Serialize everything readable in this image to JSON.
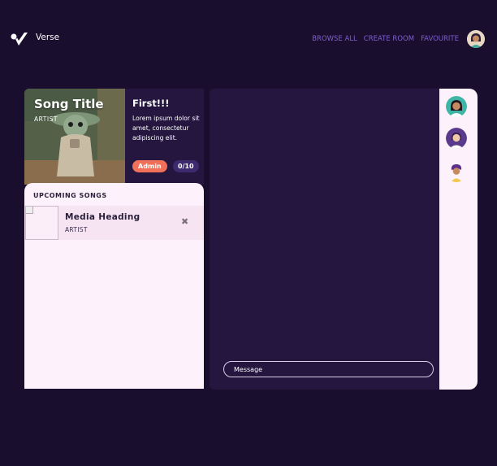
{
  "header": {
    "app_name": "Verse",
    "nav": [
      "BROWSE ALL",
      "CREATE ROOM",
      "FAVOURITE"
    ],
    "logo_icon": "check-logo-icon",
    "profile_icon": "user-avatar-icon"
  },
  "now_playing": {
    "title": "Song Title",
    "artist": "ARTIST"
  },
  "room": {
    "title": "First!!!",
    "description": "Lorem ipsum dolor sit amet, consectetur adipiscing elit.",
    "role": "Admin",
    "members_count": "0/10"
  },
  "queue": {
    "heading": "UPCOMING SONGS",
    "items": [
      {
        "title": "Media Heading",
        "artist": "ARTIST",
        "remove_icon": "close-icon"
      }
    ]
  },
  "chat": {
    "placeholder": "Message"
  },
  "members": [
    "member-avatar-1",
    "member-avatar-2",
    "member-avatar-3"
  ],
  "colors": {
    "background": "#1a0e2e",
    "panel_dark": "#24163f",
    "panel_light": "#fdf1fb",
    "accent": "#7b5fd0",
    "admin": "#f0705a"
  }
}
